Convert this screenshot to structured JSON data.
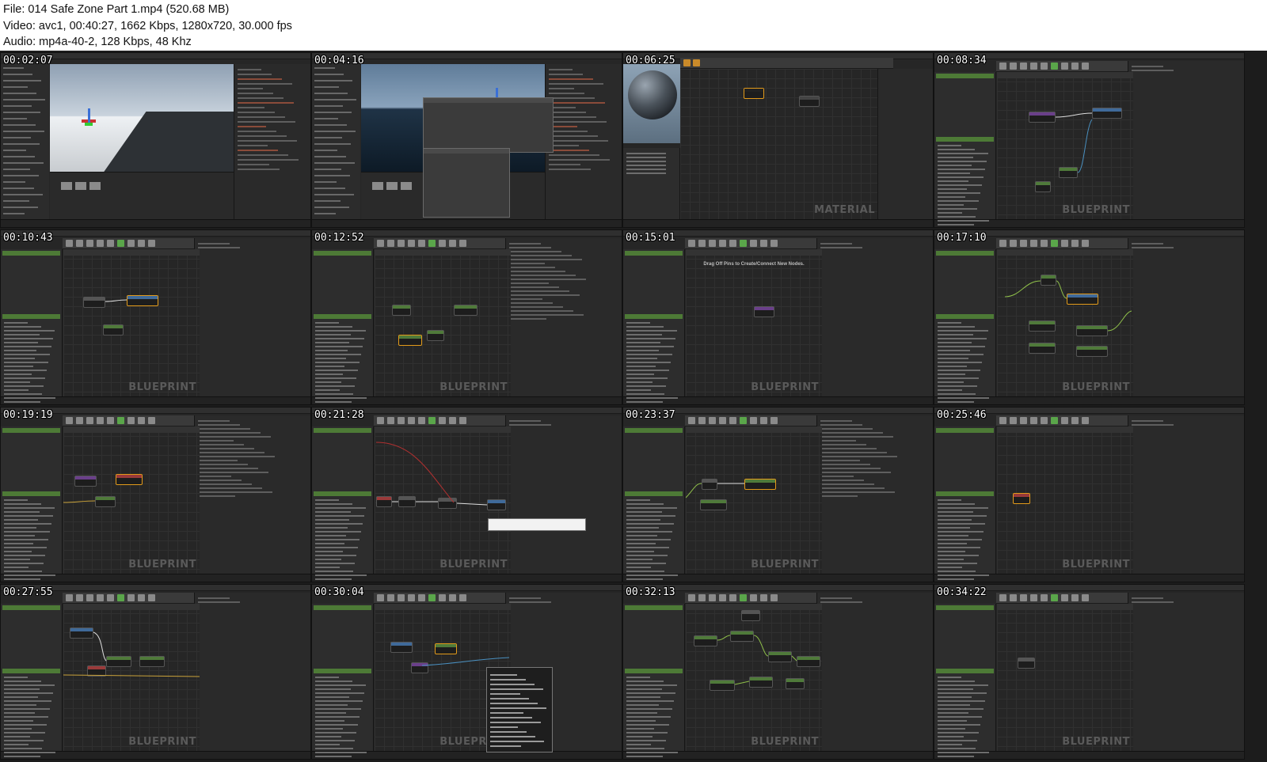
{
  "file_info": {
    "line1": "File: 014 Safe Zone Part 1.mp4 (520.68 MB)",
    "line2": "Video: avc1, 00:40:27, 1662 Kbps, 1280x720, 30.000 fps",
    "line3": "Audio: mp4a-40-2, 128 Kbps, 48 Khz"
  },
  "thumbnails": [
    {
      "time": "00:02:07",
      "kind": "level",
      "brand": ""
    },
    {
      "time": "00:04:16",
      "kind": "level-dialog",
      "brand": ""
    },
    {
      "time": "00:06:25",
      "kind": "material",
      "brand": "MATERIAL"
    },
    {
      "time": "00:08:34",
      "kind": "blueprint",
      "brand": "BLUEPRINT"
    },
    {
      "time": "00:10:43",
      "kind": "blueprint",
      "brand": "BLUEPRINT"
    },
    {
      "time": "00:12:52",
      "kind": "blueprint-details",
      "brand": "BLUEPRINT"
    },
    {
      "time": "00:15:01",
      "kind": "blueprint-empty",
      "brand": "BLUEPRINT",
      "hint": "Drag Off Pins to Create/Connect New Nodes."
    },
    {
      "time": "00:17:10",
      "kind": "blueprint",
      "brand": "BLUEPRINT"
    },
    {
      "time": "00:19:19",
      "kind": "blueprint-details",
      "brand": "BLUEPRINT"
    },
    {
      "time": "00:21:28",
      "kind": "blueprint-tooltip",
      "brand": "BLUEPRINT"
    },
    {
      "time": "00:23:37",
      "kind": "blueprint-details",
      "brand": "BLUEPRINT"
    },
    {
      "time": "00:25:46",
      "kind": "blueprint",
      "brand": "BLUEPRINT"
    },
    {
      "time": "00:27:55",
      "kind": "blueprint",
      "brand": "BLUEPRINT"
    },
    {
      "time": "00:30:04",
      "kind": "blueprint-menu",
      "brand": "BLUEPRINT"
    },
    {
      "time": "00:32:13",
      "kind": "blueprint",
      "brand": "BLUEPRINT"
    },
    {
      "time": "00:34:22",
      "kind": "blueprint",
      "brand": "BLUEPRINT"
    }
  ],
  "colors": {
    "node_select": "#e29a1a",
    "node_green": "#4f7a3a",
    "node_blue": "#3f6a9a",
    "node_purple": "#6a3f8a",
    "node_red": "#9a3a3a",
    "wire_red": "#b03030",
    "wire_blue": "#4a90c0",
    "wire_green": "#8fc04a"
  }
}
